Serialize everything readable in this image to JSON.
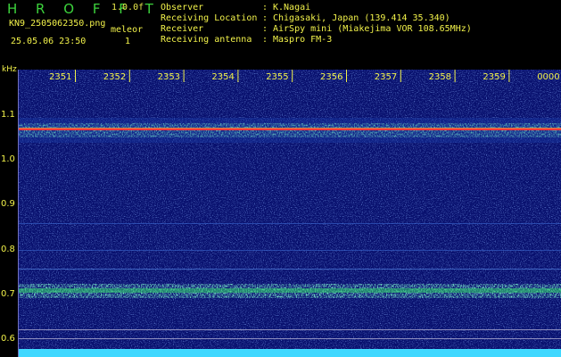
{
  "header": {
    "app_title": "H R O F F T",
    "version": "1.0.0f",
    "file_name": "KN9_2505062350.png",
    "datetime": "25.05.06 23:50",
    "mode_label": "meleor",
    "mode_value": "1",
    "info": [
      {
        "key": "Observer",
        "value": "K.Nagai"
      },
      {
        "key": "Receiving Location",
        "value": "Chigasaki, Japan (139.414 35.340)"
      },
      {
        "key": "Receiver",
        "value": "AirSpy mini (Miakejima VOR 108.65MHz)"
      },
      {
        "key": "Receiving antenna",
        "value": "Maspro FM-3"
      }
    ]
  },
  "axis": {
    "unit": "kHz",
    "time_labels": [
      "2351",
      "2352",
      "2353",
      "2354",
      "2355",
      "2356",
      "2357",
      "2358",
      "2359",
      "0000"
    ],
    "freq_labels": [
      "1.1",
      "1.0",
      "0.9",
      "0.8",
      "0.7",
      "0.6"
    ]
  },
  "colors": {
    "background": "#000000",
    "plot_bg": "#08106e",
    "label": "#f2f24a",
    "title": "#3cd23c",
    "carrier": "#ff4040",
    "band": "#30d060",
    "noise_floor": "#40e0ff"
  }
}
